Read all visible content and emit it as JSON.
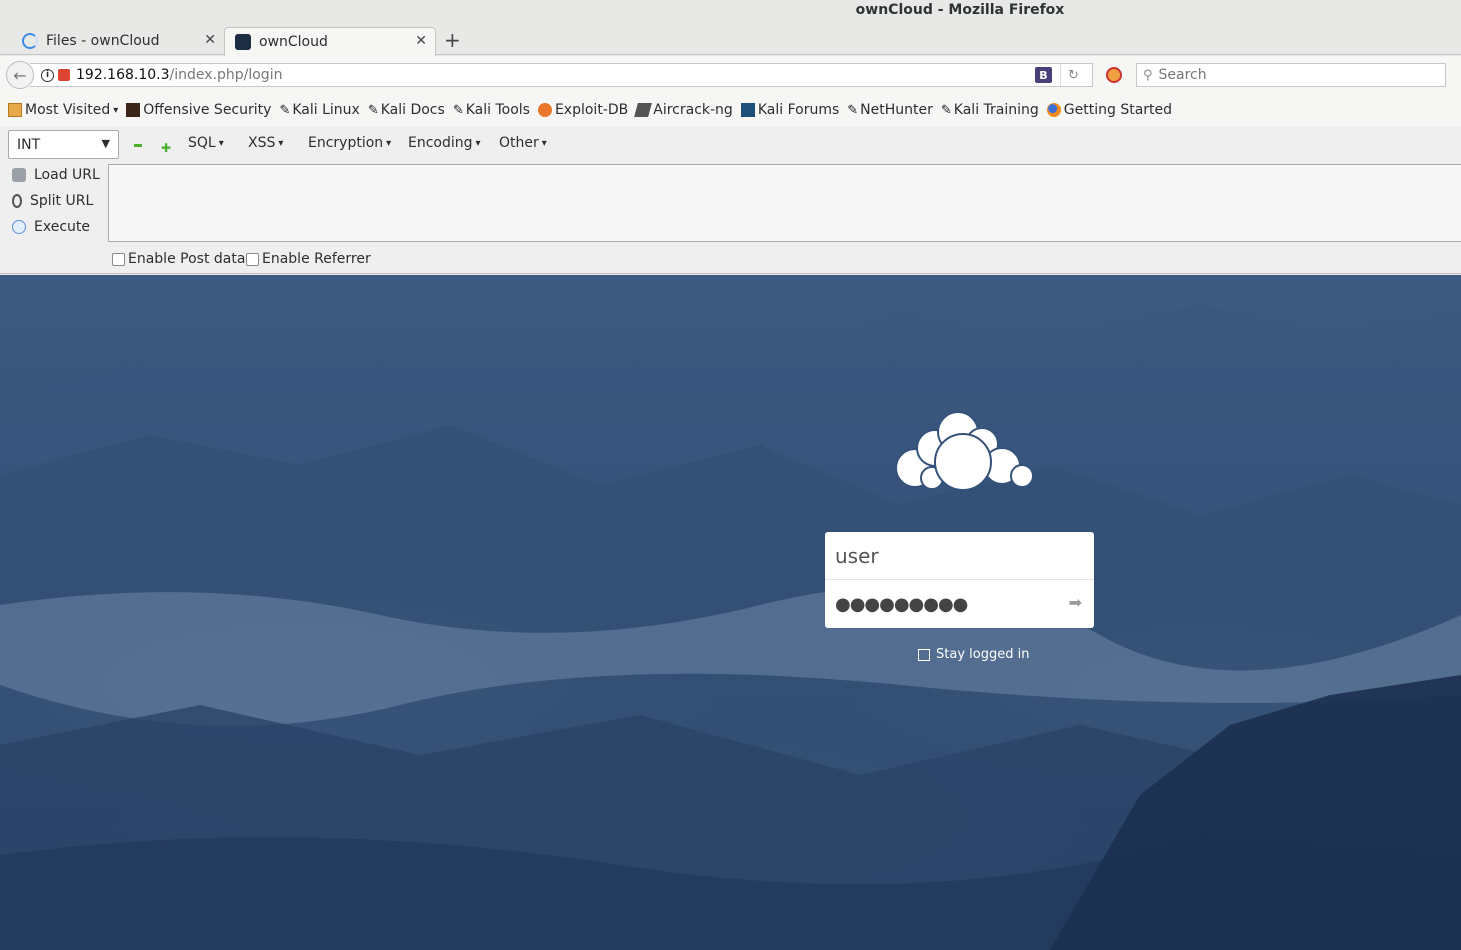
{
  "window": {
    "title": "ownCloud - Mozilla Firefox"
  },
  "tabs": [
    {
      "label": "Files - ownCloud",
      "active": false
    },
    {
      "label": "ownCloud",
      "active": true
    }
  ],
  "navbar": {
    "url_host": "192.168.10.3",
    "url_path": "/index.php/login",
    "search_placeholder": "Search",
    "b_button": "B"
  },
  "bookmarks": [
    {
      "label": "Most Visited",
      "icon": "folder-icon",
      "dropdown": true
    },
    {
      "label": "Offensive Security",
      "icon": "offsec-icon"
    },
    {
      "label": "Kali Linux",
      "icon": "kali-dragon-icon"
    },
    {
      "label": "Kali Docs",
      "icon": "kali-dragon-icon"
    },
    {
      "label": "Kali Tools",
      "icon": "kali-dragon-icon"
    },
    {
      "label": "Exploit-DB",
      "icon": "exploit-db-icon"
    },
    {
      "label": "Aircrack-ng",
      "icon": "aircrack-icon"
    },
    {
      "label": "Kali Forums",
      "icon": "kali-forums-icon"
    },
    {
      "label": "NetHunter",
      "icon": "kali-dragon-icon"
    },
    {
      "label": "Kali Training",
      "icon": "kali-dragon-icon"
    },
    {
      "label": "Getting Started",
      "icon": "firefox-icon"
    }
  ],
  "hackbar": {
    "select_value": "INT",
    "menus": [
      "SQL",
      "XSS",
      "Encryption",
      "Encoding",
      "Other"
    ],
    "load_url": "Load URL",
    "split_url": "Split URL",
    "execute": "Execute",
    "enable_post": "Enable Post data",
    "enable_referrer": "Enable Referrer"
  },
  "login": {
    "username_value": "user",
    "password_dots": "●●●●●●●●●",
    "stay_logged_in": "Stay logged in"
  },
  "colors": {
    "background_blue": "#35527a",
    "login_box": "#ffffff"
  }
}
